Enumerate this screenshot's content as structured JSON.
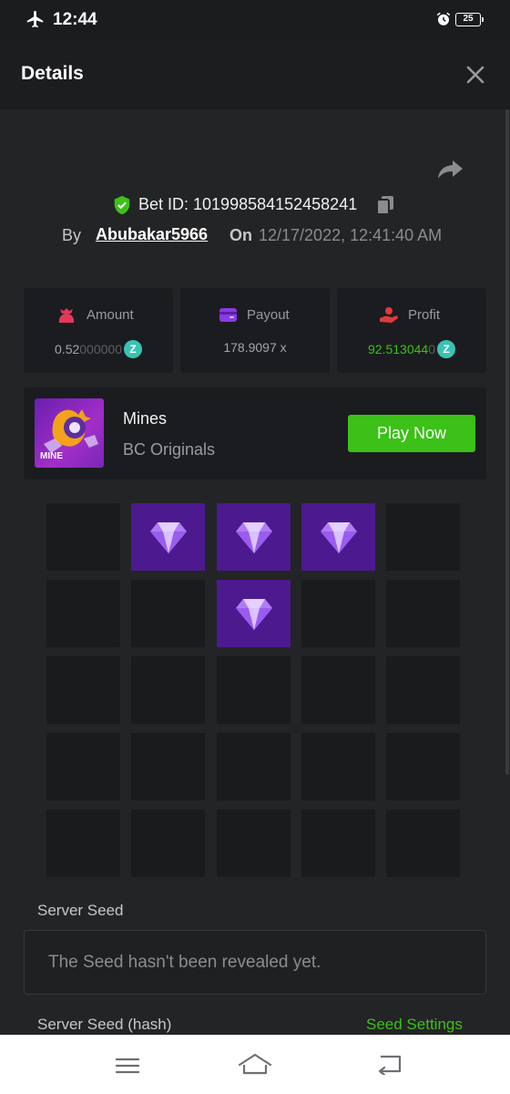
{
  "status_bar": {
    "time": "12:44",
    "battery": "25"
  },
  "header": {
    "title": "Details"
  },
  "bet": {
    "id_label": "Bet ID: 101998584152458241",
    "by_label": "By",
    "username": "Abubakar5966",
    "on_label": "On",
    "datetime": "12/17/2022, 12:41:40 AM"
  },
  "stats": [
    {
      "title": "Amount",
      "value_main": "0.52",
      "value_dim": "000000",
      "icon": "money-bag-icon",
      "color": "#e2385a"
    },
    {
      "title": "Payout",
      "value_main": "178.9097 x",
      "value_dim": "",
      "icon": "wallet-icon",
      "color": "#8b3be6"
    },
    {
      "title": "Profit",
      "value_main": "92.513044",
      "value_dim": "0",
      "icon": "hand-coin-icon",
      "color": "#e23a3a"
    }
  ],
  "game": {
    "name": "Mines",
    "provider": "BC Originals",
    "thumb_text": "MINE",
    "play_label": "Play Now"
  },
  "grid": {
    "rows": 5,
    "cols": 5,
    "gems": [
      [
        0,
        1
      ],
      [
        0,
        2
      ],
      [
        0,
        3
      ],
      [
        1,
        2
      ]
    ]
  },
  "seed": {
    "server_seed_label": "Server Seed",
    "server_seed_value": "The Seed hasn't been revealed yet.",
    "hash_label": "Server Seed (hash)",
    "settings_label": "Seed Settings"
  },
  "colors": {
    "accent_green": "#3bc117",
    "gem_bg": "#4c1a8e",
    "coin": "#39c3b4"
  }
}
